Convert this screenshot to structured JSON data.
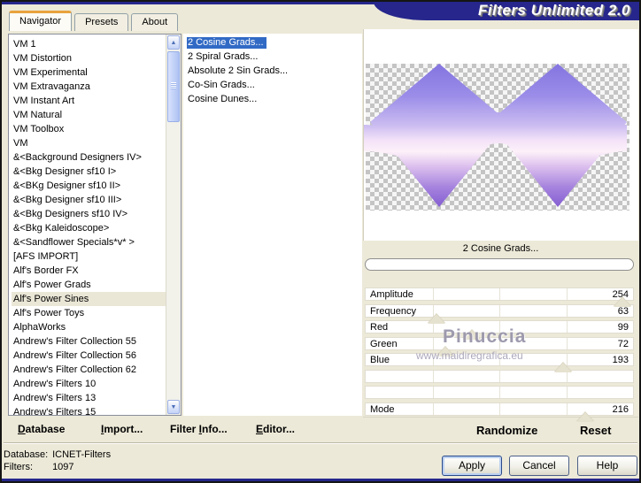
{
  "window": {
    "title": "Filters Unlimited 2.0"
  },
  "colors": {
    "banner": "#26268c",
    "background": "#ece9d8",
    "selection": "#316ac5",
    "tab_accent": "#e8a33d",
    "thumb": "#e6e2d0"
  },
  "icons": {
    "scroll_up_icon": "▲",
    "scroll_down_icon": "▼"
  },
  "tabs": [
    {
      "label": "Navigator",
      "active": true
    },
    {
      "label": "Presets",
      "active": false
    },
    {
      "label": "About",
      "active": false
    }
  ],
  "category_list": {
    "selected": "Alf's Power Sines",
    "items": [
      "VM 1",
      "VM Distortion",
      "VM Experimental",
      "VM Extravaganza",
      "VM Instant Art",
      "VM Natural",
      "VM Toolbox",
      "VM",
      "&<Background Designers IV>",
      "&<Bkg Designer sf10 I>",
      "&<BKg Designer sf10 II>",
      "&<Bkg Designer sf10 III>",
      "&<Bkg Designers sf10 IV>",
      "&<Bkg Kaleidoscope>",
      "&<Sandflower Specials*v* >",
      "[AFS IMPORT]",
      "Alf's Border FX",
      "Alf's Power Grads",
      "Alf's Power Sines",
      "Alf's Power Toys",
      "AlphaWorks",
      "Andrew's Filter Collection 55",
      "Andrew's Filter Collection 56",
      "Andrew's Filter Collection 62",
      "Andrew's Filters 10",
      "Andrew's Filters 13",
      "Andrew's Filters 15"
    ]
  },
  "filter_list": {
    "selected": "2 Cosine Grads...",
    "items": [
      "2 Cosine Grads...",
      "2 Spiral Grads...",
      "Absolute 2 Sin Grads...",
      "Co-Sin Grads...",
      "Cosine Dunes..."
    ]
  },
  "preview": {
    "caption": "2 Cosine Grads...",
    "progress_percent": 0,
    "watermark_line1": "Pinuccia",
    "watermark_line2": "www.maidiregrafica.eu"
  },
  "sliders": {
    "max": 255,
    "rows": [
      {
        "label": "Amplitude",
        "value": 254
      },
      {
        "label": "Frequency",
        "value": 63
      },
      {
        "label": "Red",
        "value": 99
      },
      {
        "label": "Green",
        "value": 72
      },
      {
        "label": "Blue",
        "value": 193
      },
      {
        "label": "",
        "value": null
      },
      {
        "label": "",
        "value": null
      },
      {
        "label": "Mode",
        "value": 216
      }
    ]
  },
  "panel_buttons": {
    "randomize": "Randomize",
    "reset": "Reset"
  },
  "toolbar": {
    "items": [
      {
        "label": "Database",
        "underline_index": 0
      },
      {
        "label": "Import...",
        "underline_index": 0
      },
      {
        "label": "Filter Info...",
        "underline_index": 7
      },
      {
        "label": "Editor...",
        "underline_index": 0
      }
    ]
  },
  "status": {
    "database_label": "Database:",
    "database_value": "ICNET-Filters",
    "filters_label": "Filters:",
    "filters_value": "1097"
  },
  "dialog_buttons": {
    "apply": "Apply",
    "cancel": "Cancel",
    "help": "Help"
  }
}
